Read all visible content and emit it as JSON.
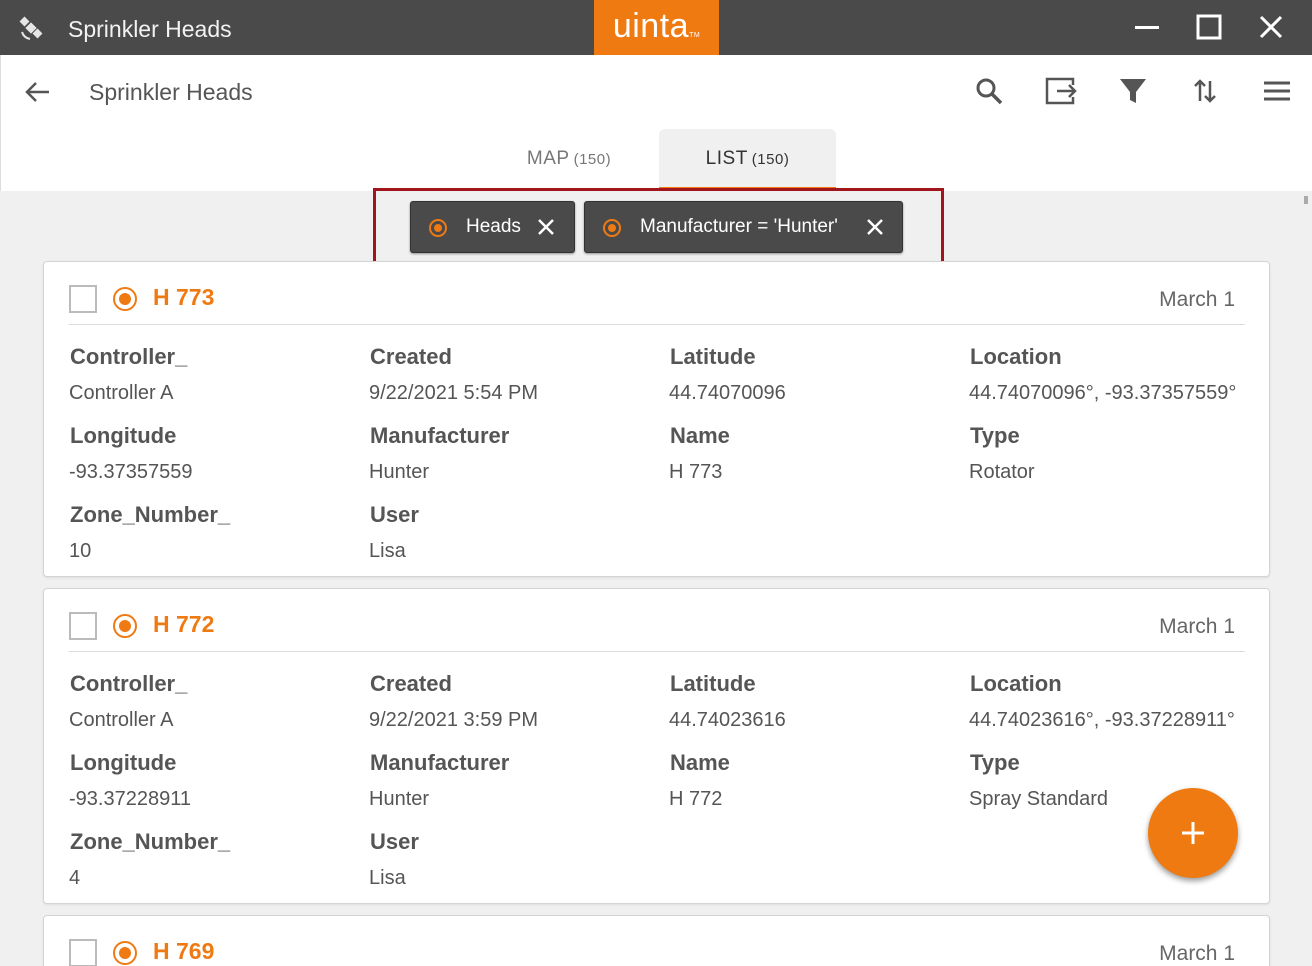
{
  "window": {
    "title": "Sprinkler Heads",
    "brand": "uinta",
    "brand_suffix": "TM",
    "accent_color": "#ef7a12",
    "titlebar_color": "#4a4a4a"
  },
  "header": {
    "page_title": "Sprinkler Heads",
    "tools": [
      "search-icon",
      "export-icon",
      "filter-icon",
      "sort-icon",
      "menu-icon"
    ]
  },
  "tabs": [
    {
      "label": "MAP",
      "count": "(150)",
      "active": false
    },
    {
      "label": "LIST",
      "count": "(150)",
      "active": true
    }
  ],
  "filters": [
    {
      "label": "Heads"
    },
    {
      "label": "Manufacturer = 'Hunter'"
    }
  ],
  "cards": [
    {
      "name": "H 773",
      "date": "March 1",
      "fields": [
        {
          "label": "Controller_",
          "value": "Controller A"
        },
        {
          "label": "Created",
          "value": "9/22/2021 5:54 PM"
        },
        {
          "label": "Latitude",
          "value": "44.74070096"
        },
        {
          "label": "Location",
          "value": "44.74070096°, -93.37357559°"
        },
        {
          "label": "Longitude",
          "value": "-93.37357559"
        },
        {
          "label": "Manufacturer",
          "value": "Hunter"
        },
        {
          "label": "Name",
          "value": "H 773"
        },
        {
          "label": "Type",
          "value": "Rotator"
        },
        {
          "label": "Zone_Number_",
          "value": "10"
        },
        {
          "label": "User",
          "value": "Lisa"
        }
      ]
    },
    {
      "name": "H 772",
      "date": "March 1",
      "fields": [
        {
          "label": "Controller_",
          "value": "Controller A"
        },
        {
          "label": "Created",
          "value": "9/22/2021 3:59 PM"
        },
        {
          "label": "Latitude",
          "value": "44.74023616"
        },
        {
          "label": "Location",
          "value": "44.74023616°, -93.37228911°"
        },
        {
          "label": "Longitude",
          "value": "-93.37228911"
        },
        {
          "label": "Manufacturer",
          "value": "Hunter"
        },
        {
          "label": "Name",
          "value": "H 772"
        },
        {
          "label": "Type",
          "value": "Spray Standard"
        },
        {
          "label": "Zone_Number_",
          "value": "4"
        },
        {
          "label": "User",
          "value": "Lisa"
        }
      ]
    },
    {
      "name": "H 769",
      "date": "March 1"
    }
  ],
  "fab": {
    "icon": "plus-icon"
  }
}
